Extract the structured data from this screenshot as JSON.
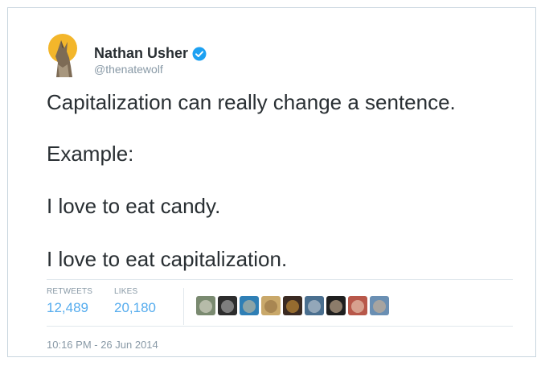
{
  "user": {
    "name": "Nathan Usher",
    "handle": "@thenatewolf",
    "verified": true,
    "avatar_icon": "howling-wolf-moon-icon"
  },
  "tweet": {
    "lines": [
      "Capitalization can really change a sentence.",
      "Example:",
      "I love to eat candy.",
      "I love to eat capitalization."
    ]
  },
  "stats": {
    "retweets_label": "RETWEETS",
    "retweets_value": "12,489",
    "likes_label": "LIKES",
    "likes_value": "20,180"
  },
  "likers": [
    {
      "name": "liker-avatar-1",
      "color": "#7a8a70",
      "accent": "#e8e4d8"
    },
    {
      "name": "liker-avatar-2",
      "color": "#2d2d2d",
      "accent": "#bfbfbf"
    },
    {
      "name": "liker-avatar-3",
      "color": "#2f7fb5",
      "accent": "#d9c39a"
    },
    {
      "name": "liker-avatar-4",
      "color": "#c9a86a",
      "accent": "#8c6a3e"
    },
    {
      "name": "liker-avatar-5",
      "color": "#3a2a22",
      "accent": "#e0a03a"
    },
    {
      "name": "liker-avatar-6",
      "color": "#4a6f8f",
      "accent": "#cfd6dc"
    },
    {
      "name": "liker-avatar-7",
      "color": "#1f1f1f",
      "accent": "#e6c9a8"
    },
    {
      "name": "liker-avatar-8",
      "color": "#b8584a",
      "accent": "#f1dcc7"
    },
    {
      "name": "liker-avatar-9",
      "color": "#6a8fb3",
      "accent": "#d8b690"
    }
  ],
  "timestamp": "10:16 PM - 26 Jun 2014",
  "colors": {
    "accent": "#55acee",
    "text": "#292f33",
    "muted": "#8899a6",
    "border": "#c9d6df",
    "verified_badge": "#1da1f2"
  }
}
